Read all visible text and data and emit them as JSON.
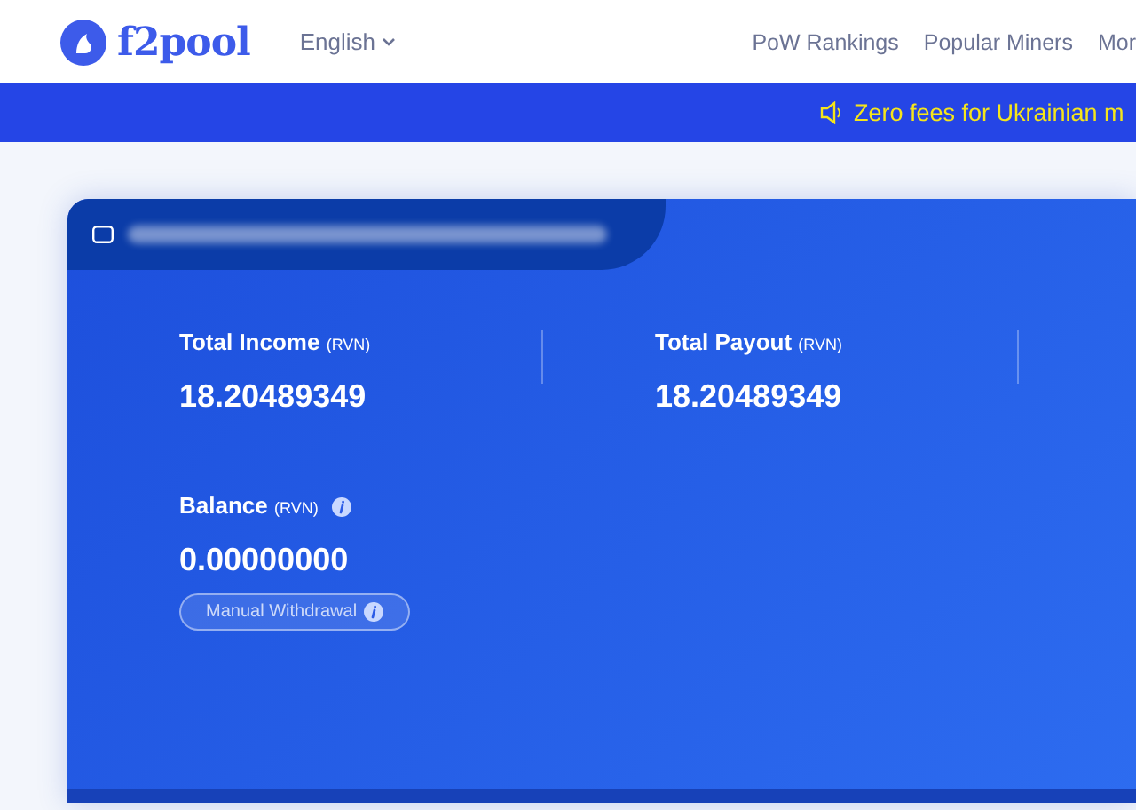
{
  "header": {
    "brand": "f2pool",
    "language": "English",
    "nav": [
      "PoW Rankings",
      "Popular Miners",
      "Mor"
    ]
  },
  "banner": {
    "text": "Zero fees for Ukrainian m"
  },
  "account": {
    "stats": [
      {
        "label": "Total Income",
        "unit": "(RVN)",
        "value": "18.20489349"
      },
      {
        "label": "Total Payout",
        "unit": "(RVN)",
        "value": "18.20489349"
      }
    ],
    "balance": {
      "label": "Balance",
      "unit": "(RVN)",
      "value": "0.00000000",
      "button": "Manual Withdrawal"
    }
  }
}
